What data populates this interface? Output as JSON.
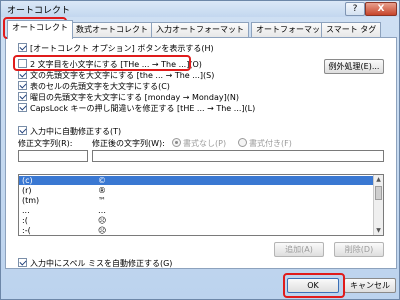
{
  "window": {
    "title": "オートコレクト",
    "help": "?",
    "close": "X"
  },
  "tabs": [
    {
      "label": "オートコレクト",
      "active": true
    },
    {
      "label": "数式オートコレクト"
    },
    {
      "label": "入力オートフォーマット"
    },
    {
      "label": "オートフォーマット"
    },
    {
      "label": "スマート タグ"
    }
  ],
  "options": {
    "show_buttons": "[オートコレクト オプション] ボタンを表示する(H)",
    "second_lower": "2 文字目を小文字にする [THe ... → The ...](O)",
    "first_sentence": "文の先頭文字を大文字にする [the ... → The ...](S)",
    "first_cell": "表のセルの先頭文字を大文字にする(C)",
    "day_names": "曜日の先頭文字を大文字にする [monday → Monday](N)",
    "capslock": "CapsLock キーの押し間違いを修正する [tHE ... → The ...](L)"
  },
  "exceptions_button": "例外処理(E)...",
  "replace_as_type": "入力中に自動修正する(T)",
  "replace_label": "修正文字列(R):",
  "with_label": "修正後の文字列(W):",
  "format_plain": "書式なし(P)",
  "format_formatted": "書式付き(F)",
  "list_rows": [
    {
      "from": "(c)",
      "to": "©"
    },
    {
      "from": "(r)",
      "to": "®"
    },
    {
      "from": "(tm)",
      "to": "™"
    },
    {
      "from": "...",
      "to": "…"
    },
    {
      "from": ":(",
      "to": "☹"
    },
    {
      "from": ":-(",
      "to": "☹"
    }
  ],
  "add_button": "追加(A)",
  "delete_button": "削除(D)",
  "spell_check": "入力中にスペル ミスを自動修正する(G)",
  "ok_button": "OK",
  "cancel_button": "キャンセル"
}
